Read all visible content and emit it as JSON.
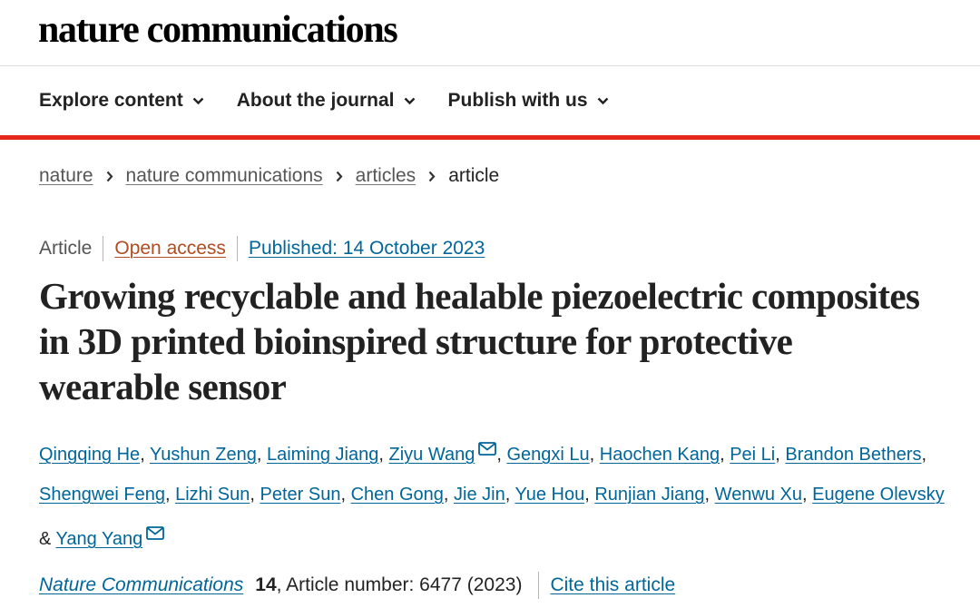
{
  "header": {
    "logo_text": "nature communications"
  },
  "nav": {
    "items": [
      {
        "label": "Explore content"
      },
      {
        "label": "About the journal"
      },
      {
        "label": "Publish with us"
      }
    ]
  },
  "breadcrumb": {
    "items": [
      "nature",
      "nature communications",
      "articles"
    ],
    "current": "article"
  },
  "article": {
    "type": "Article",
    "access": "Open access",
    "published": "Published: 14 October 2023",
    "title": "Growing recyclable and healable piezoelectric composites in 3D printed bioinspired structure for protective wearable sensor",
    "authors": [
      "Qingqing He",
      "Yushun Zeng",
      "Laiming Jiang",
      "Ziyu Wang",
      "Gengxi Lu",
      "Haochen Kang",
      "Pei Li",
      "Brandon Bethers",
      "Shengwei Feng",
      "Lizhi Sun",
      "Peter Sun",
      "Chen Gong",
      "Jie Jin",
      "Yue Hou",
      "Runjian Jiang",
      "Wenwu Xu",
      "Eugene Olevsky",
      "Yang Yang"
    ],
    "author_conjunction": "&",
    "citation": {
      "journal": "Nature Communications",
      "volume": "14",
      "article_number": ", Article number: 6477 (2023)",
      "cite_label": "Cite this article"
    }
  },
  "colors": {
    "accent_bar": "#e4281c",
    "link": "#006699",
    "open_access": "#b04c22"
  },
  "icons": {
    "nav_chevron": "chevron-down-icon",
    "breadcrumb_sep": "chevron-right-icon",
    "author_contact": "mail-icon"
  }
}
